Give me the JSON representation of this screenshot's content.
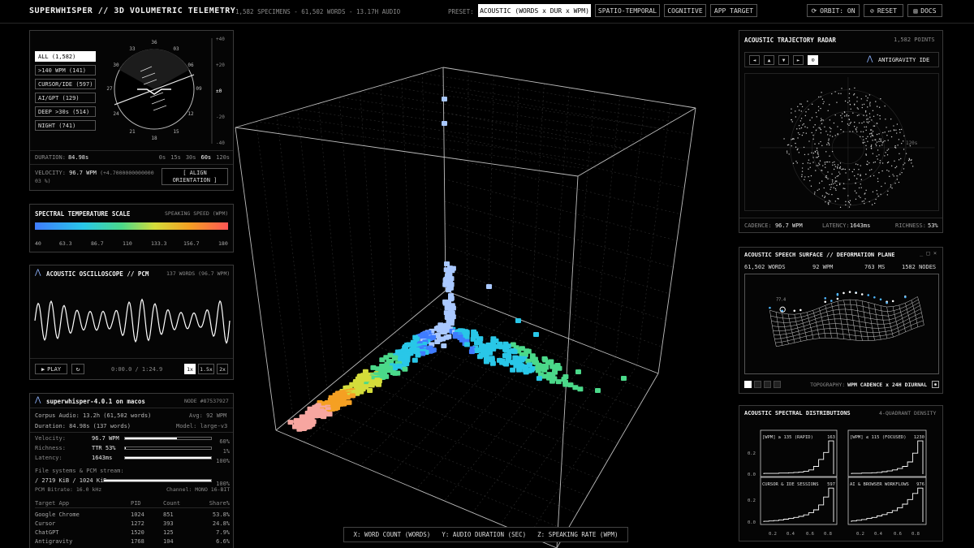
{
  "header": {
    "title": "SUPERWHISPER // 3D VOLUMETRIC TELEMETRY",
    "stats": "1,582 SPECIMENS - 61,502 WORDS - 13.17H AUDIO",
    "preset_label": "PRESET:",
    "presets": [
      "ACOUSTIC (WORDS x DUR x WPM)",
      "SPATIO-TEMPORAL",
      "COGNITIVE",
      "APP TARGET"
    ],
    "orbit": "ORBIT: ON",
    "reset": "RESET",
    "docs": "DOCS"
  },
  "orientation": {
    "filters": [
      "ALL (1,582)",
      ">140 WPM (141)",
      "CURSOR/IDE (597)",
      "AI/GPT (129)",
      "DEEP >30s (514)",
      "NIGHT (741)"
    ],
    "compass_labels": [
      "36",
      "03",
      "06",
      "09",
      "12",
      "15",
      "18",
      "21",
      "24",
      "27",
      "30",
      "33"
    ],
    "pitch_ticks": [
      "+40",
      "+20",
      "±0",
      "-20",
      "-40"
    ],
    "duration_label": "DURATION:",
    "duration_value": "84.98s",
    "duration_ticks": [
      "0s",
      "15s",
      "30s",
      "60s",
      "120s"
    ],
    "velocity_label": "VELOCITY:",
    "velocity_value": "96.7 WPM",
    "velocity_delta": "(+4.700000000000003 %)",
    "align_button": "[ ALIGN ORIENTATION ]"
  },
  "spectral_scale": {
    "title": "SPECTRAL TEMPERATURE SCALE",
    "subtitle": "SPEAKING SPEED (WPM)",
    "ticks": [
      "40",
      "63.3",
      "86.7",
      "110",
      "133.3",
      "156.7",
      "180"
    ]
  },
  "oscilloscope": {
    "title": "ACOUSTIC OSCILLOSCOPE // PCM",
    "meta": "137 WORDS (96.7 WPM)",
    "play": "PLAY",
    "time": "0:00.0 / 1:24.9",
    "speeds": [
      "1x",
      "1.5x",
      "2x"
    ]
  },
  "node": {
    "title": "superwhisper-4.0.1 on macos",
    "node_id": "NODE #87537927",
    "corpus": "Corpus Audio: 13.2h (61,502 words)",
    "avg": "Avg: 92 WPM",
    "duration": "Duration: 84.98s (137 words)",
    "model": "Model: large-v3",
    "metrics": [
      {
        "label": "Velocity:",
        "value": "96.7 WPM",
        "pct": "60%",
        "fill": 0.6
      },
      {
        "label": "Richness:",
        "value": "TTR 53%",
        "pct": "1%",
        "fill": 0.01
      },
      {
        "label": "Latency:",
        "value": "1643ms",
        "pct": "100%",
        "fill": 1.0
      }
    ],
    "fs_label": "File systems & PCM stream:",
    "fs_value": "/ 2719 KiB / 1024 KiB",
    "fs_pct": "100%",
    "fs_fill": 1.0,
    "bitrate": "PCM Bitrate: 16.0 kHz",
    "channel": "Channel: MONO 16-BIT",
    "table_headers": [
      "Target App",
      "PID",
      "Count",
      "Share%"
    ],
    "table_rows": [
      [
        "Google Chrome",
        "1024",
        "851",
        "53.8%"
      ],
      [
        "Cursor",
        "1272",
        "393",
        "24.8%"
      ],
      [
        "ChatGPT",
        "1520",
        "125",
        "7.9%"
      ],
      [
        "Antigravity",
        "1768",
        "104",
        "6.6%"
      ]
    ]
  },
  "axis_caption": {
    "x": "X: WORD COUNT (WORDS)",
    "y": "Y: AUDIO DURATION (SEC)",
    "z": "Z: SPEAKING RATE (WPM)"
  },
  "radar": {
    "title": "ACOUSTIC TRAJECTORY RADAR",
    "count": "1,582 POINTS",
    "nav": [
      "◄",
      "▲",
      "▼",
      "►",
      "⊙"
    ],
    "app": "ANTIGRAVITY IDE",
    "ring_label": "120s",
    "cadence_label": "CADENCE:",
    "cadence": "96.7 WPM",
    "latency_label": "LATENCY:",
    "latency": "1643ms",
    "richness_label": "RICHNESS:",
    "richness": "53%"
  },
  "surface": {
    "title": "ACOUSTIC SPEECH SURFACE // DEFORMATION PLANE",
    "stats": [
      "61,502 WORDS",
      "92 WPM",
      "763 MS",
      "1582 NODES"
    ],
    "topo_label": "TOPOGRAPHY:",
    "topo_value": "WPM CADENCE x 24H DIURNAL",
    "peak_label": "77.4"
  },
  "distributions": {
    "title": "ACOUSTIC SPECTRAL DISTRIBUTIONS",
    "subtitle": "4-QUADRANT DENSITY",
    "quadrants": [
      {
        "label": "[WPM] ≥ 135 (RAPID)",
        "count": "163"
      },
      {
        "label": "[WPM] ≤ 115 (FOCUSED)",
        "count": "1230"
      },
      {
        "label": "CURSOR & IDE SESSIONS",
        "count": "597"
      },
      {
        "label": "AI & BROWSER WORKFLOWS",
        "count": "976"
      }
    ],
    "y_ticks": [
      "0.2",
      "0.0"
    ],
    "x_ticks": [
      "0.2",
      "0.4",
      "0.6",
      "0.8"
    ]
  },
  "colors": {
    "accent": "#ffffff",
    "border": "#3a3a3a",
    "spectrum": [
      "#3f7cff",
      "#29c7e8",
      "#4bd98a",
      "#d4dc3a",
      "#f5a023",
      "#ff5555"
    ]
  }
}
